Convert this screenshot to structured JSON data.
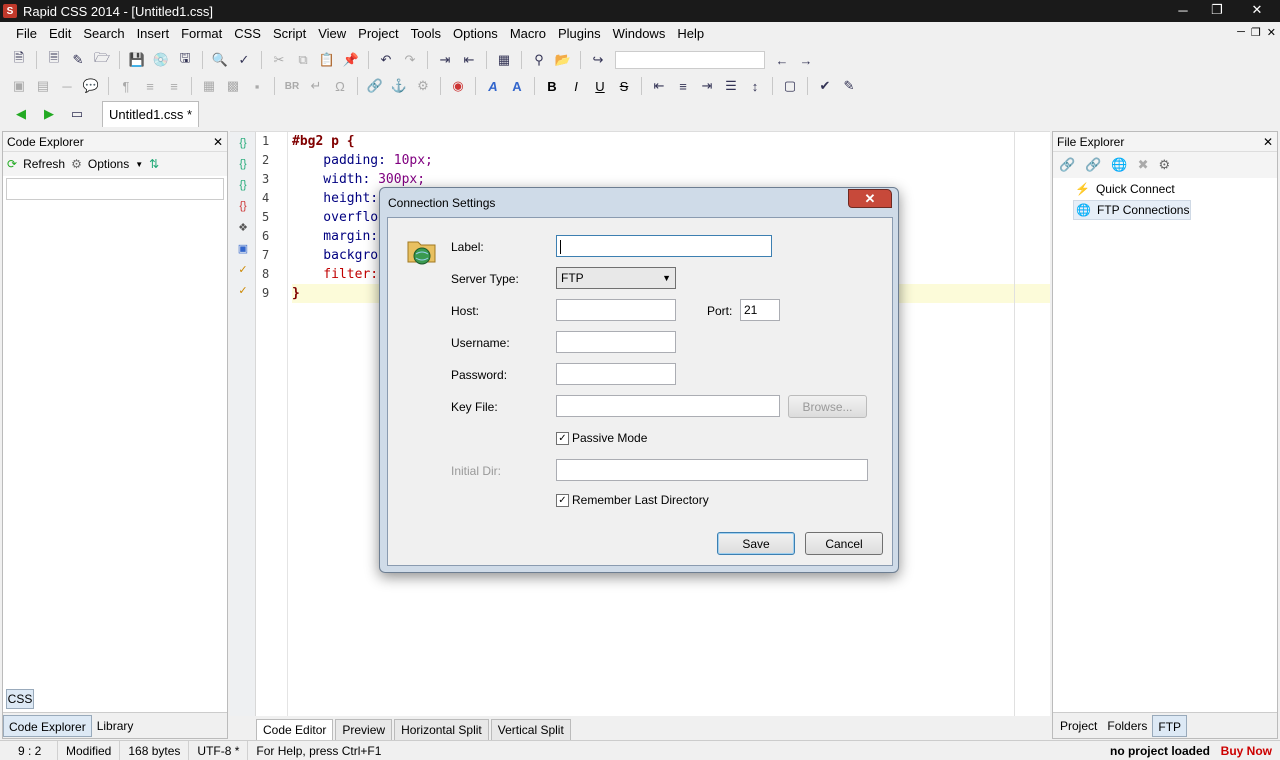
{
  "window": {
    "title": "Rapid CSS 2014 - [Untitled1.css]",
    "app_icon": "S"
  },
  "menu": [
    "File",
    "Edit",
    "Search",
    "Insert",
    "Format",
    "CSS",
    "Script",
    "View",
    "Project",
    "Tools",
    "Options",
    "Macro",
    "Plugins",
    "Windows",
    "Help"
  ],
  "doc_tab": {
    "label": "Untitled1.css *"
  },
  "code_explorer": {
    "title": "Code Explorer",
    "refresh_label": "Refresh",
    "options_label": "Options",
    "css_tab": "CSS",
    "bottom_tabs": [
      "Code Explorer",
      "Library"
    ]
  },
  "editor": {
    "line_numbers": [
      "1",
      "2",
      "3",
      "4",
      "5",
      "6",
      "7",
      "8",
      "9"
    ],
    "bottom_tabs": [
      "Code Editor",
      "Preview",
      "Horizontal Split",
      "Vertical Split"
    ],
    "code": {
      "l1_sel": "#bg2 p {",
      "l2_prop": "    padding: ",
      "l2_val": "10px;",
      "l3_prop": "    width: ",
      "l3_val": "300px;",
      "l4": "    height:",
      "l5": "    overflo",
      "l6": "    margin:",
      "l7": "    backgro",
      "l8": "    filter:",
      "l9": "}"
    }
  },
  "file_explorer": {
    "title": "File Explorer",
    "items": [
      "Quick Connect",
      "FTP Connections"
    ],
    "bottom_tabs": [
      "Project",
      "Folders",
      "FTP"
    ]
  },
  "status": {
    "pos": "9 : 2",
    "modified": "Modified",
    "size": "168 bytes",
    "encoding": "UTF-8 *",
    "help": "For Help, press Ctrl+F1",
    "project": "no project loaded",
    "buy": "Buy Now"
  },
  "dialog": {
    "title": "Connection Settings",
    "label_label": "Label:",
    "label_value": "",
    "server_type_label": "Server Type:",
    "server_type_value": "FTP",
    "host_label": "Host:",
    "host_value": "",
    "port_label": "Port:",
    "port_value": "21",
    "username_label": "Username:",
    "username_value": "",
    "password_label": "Password:",
    "password_value": "",
    "keyfile_label": "Key File:",
    "keyfile_value": "",
    "browse_label": "Browse...",
    "passive_label": "Passive Mode",
    "passive_checked": true,
    "initial_dir_label": "Initial Dir:",
    "initial_dir_value": "",
    "remember_label": "Remember Last Directory",
    "remember_checked": true,
    "save_label": "Save",
    "cancel_label": "Cancel"
  }
}
